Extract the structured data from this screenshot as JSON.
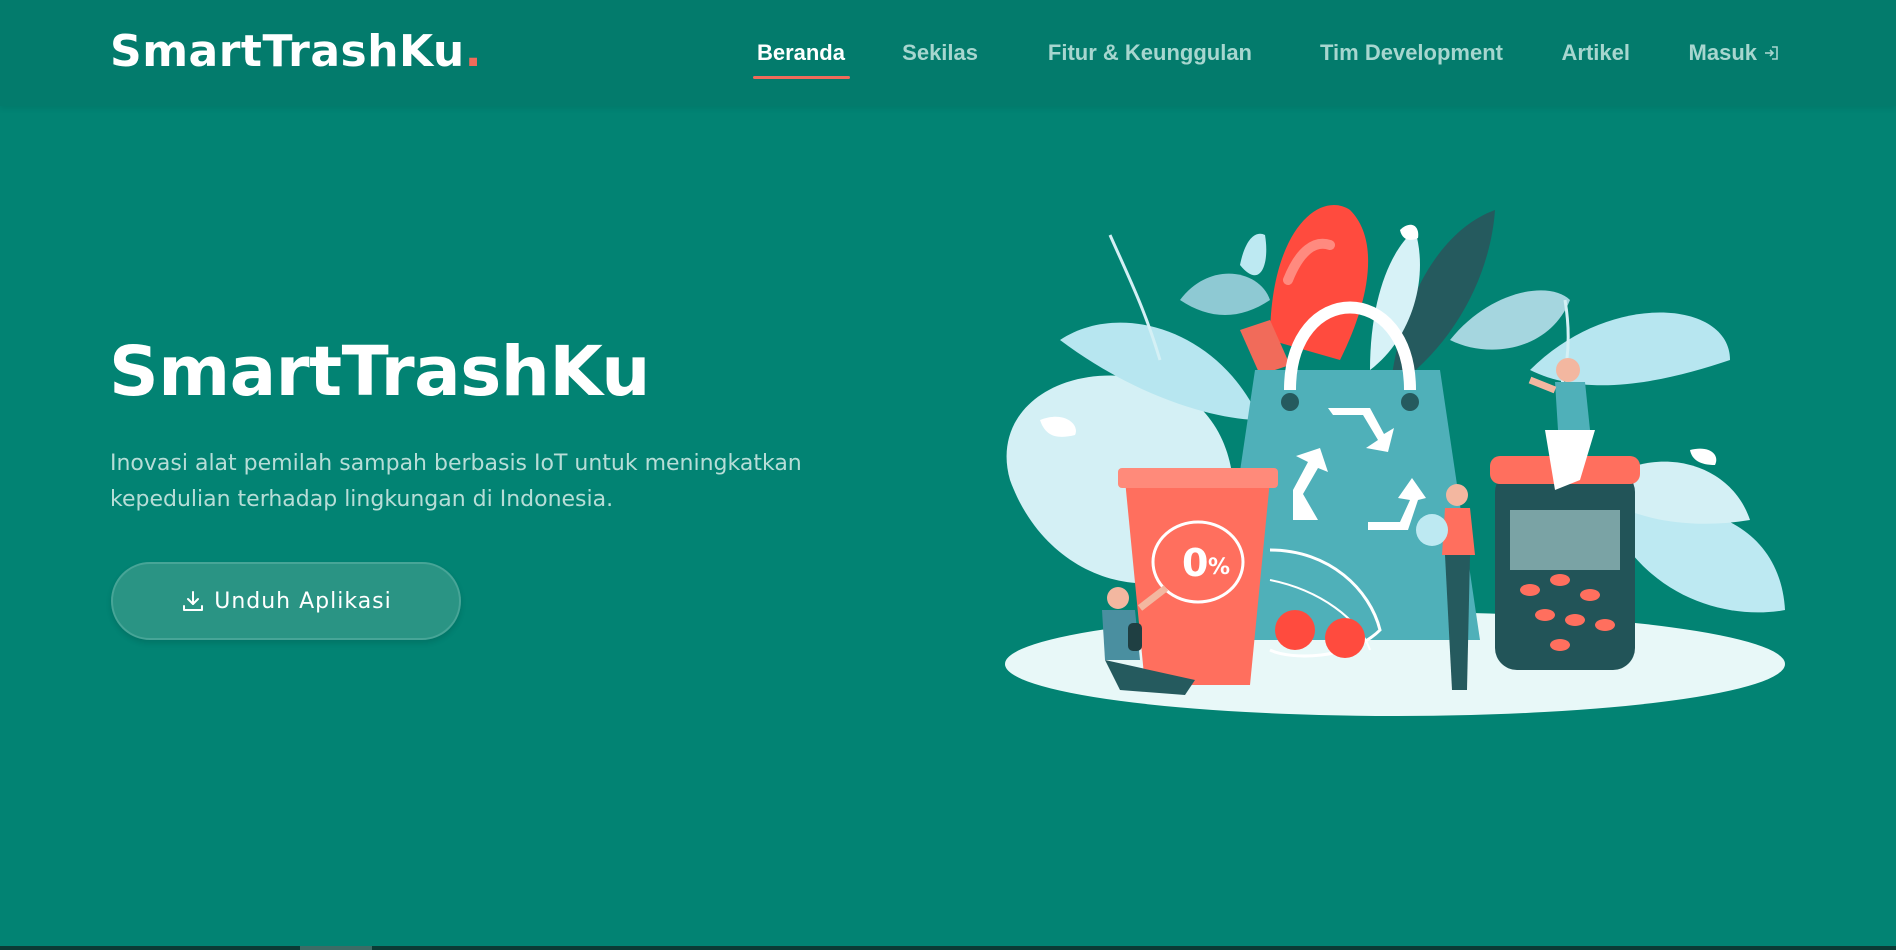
{
  "brand": {
    "name": "SmartTrashKu",
    "dot": ".",
    "accent_color": "#f16b5a",
    "background_color": "#028373"
  },
  "nav": {
    "items": [
      {
        "label": "Beranda",
        "active": true
      },
      {
        "label": "Sekilas",
        "active": false
      },
      {
        "label": "Fitur & Keunggulan",
        "active": false
      },
      {
        "label": "Tim Development",
        "active": false
      },
      {
        "label": "Artikel",
        "active": false
      },
      {
        "label": "Masuk",
        "active": false,
        "icon": "login-icon"
      }
    ]
  },
  "hero": {
    "title": "SmartTrashKu",
    "subtitle": "Inovasi alat pemilah sampah berbasis IoT untuk meningkatkan kepedulian terhadap lingkungan di Indonesia.",
    "button_label": "Unduh Aplikasi",
    "button_icon": "download-icon"
  },
  "illustration": {
    "badge_value": "0",
    "badge_unit": "%",
    "icon": "recycle-icon"
  }
}
